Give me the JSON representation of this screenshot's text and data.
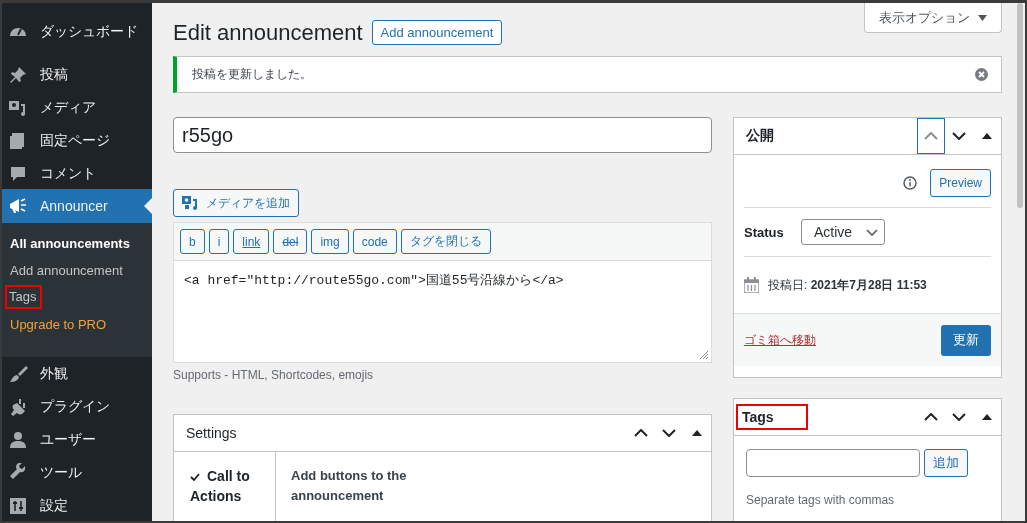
{
  "sidebar": {
    "menu": [
      {
        "label": "ダッシュボード",
        "selected": false
      },
      {
        "label": "投稿",
        "selected": false
      },
      {
        "label": "メディア",
        "selected": false
      },
      {
        "label": "固定ページ",
        "selected": false
      },
      {
        "label": "コメント",
        "selected": false
      },
      {
        "label": "Announcer",
        "selected": true,
        "children": [
          {
            "label": "All announcements",
            "selected": true,
            "kind": "link",
            "highlighted": false
          },
          {
            "label": "Add announcement",
            "selected": false,
            "kind": "link",
            "highlighted": false
          },
          {
            "label": "Tags",
            "selected": false,
            "kind": "link",
            "highlighted": true
          },
          {
            "label": "Upgrade to PRO",
            "selected": false,
            "kind": "upgrade",
            "highlighted": false
          }
        ]
      },
      {
        "label": "外観",
        "selected": false
      },
      {
        "label": "プラグイン",
        "selected": false
      },
      {
        "label": "ユーザー",
        "selected": false
      },
      {
        "label": "ツール",
        "selected": false
      },
      {
        "label": "設定",
        "selected": false
      }
    ]
  },
  "header": {
    "title": "Edit announcement",
    "add_button": "Add announcement",
    "screen_options": "表示オプション"
  },
  "notice": {
    "message": "投稿を更新しました。"
  },
  "post_title": {
    "value": "r55go"
  },
  "add_media": "メディアを追加",
  "editor": {
    "quicktags": [
      {
        "label": "b",
        "kind": "bold"
      },
      {
        "label": "i",
        "kind": "italic"
      },
      {
        "label": "link",
        "kind": "link"
      },
      {
        "label": "del",
        "kind": "del"
      },
      {
        "label": "img",
        "kind": "plain"
      },
      {
        "label": "code",
        "kind": "plain"
      },
      {
        "label": "タグを閉じる",
        "kind": "plain"
      }
    ],
    "content": "<a href=\"http://route55go.com\">国道55号沿線から</a>",
    "hint": "Supports - HTML, Shortcodes, emojis"
  },
  "settings": {
    "title": "Settings",
    "highlighted": false,
    "up_focused": false,
    "rows": [
      {
        "label": "Call to Actions",
        "checked": true,
        "description": "Add buttons to the announcement"
      }
    ]
  },
  "publish": {
    "title": "公開",
    "highlighted": false,
    "up_focused": true,
    "preview": "Preview",
    "status_label": "Status",
    "status_value": "Active",
    "date": "投稿日: **2021年7月28日 11:53**",
    "trash": "ゴミ箱へ移動",
    "update": "更新"
  },
  "tags_box": {
    "title": "Tags",
    "highlighted": true,
    "up_focused": false,
    "add": "追加",
    "hint": "Separate tags with commas"
  }
}
